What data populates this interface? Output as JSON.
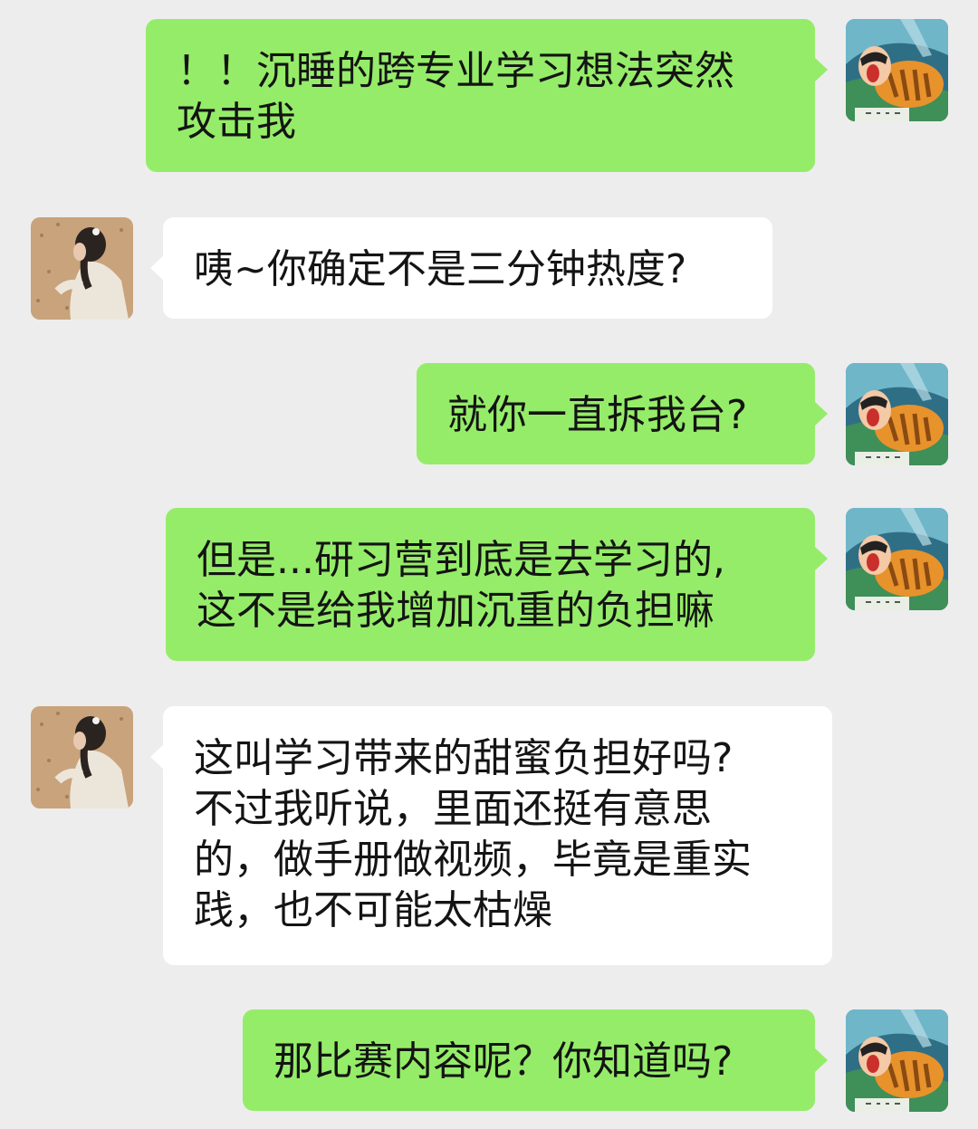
{
  "messages": [
    {
      "sender": "me",
      "text": "！！沉睡的跨专业学习想法突然\n攻击我"
    },
    {
      "sender": "friend",
      "text": "咦~你确定不是三分钟热度?"
    },
    {
      "sender": "me",
      "text": "就你一直拆我台?"
    },
    {
      "sender": "me",
      "text": "但是...研习营到底是去学习的,\n这不是给我增加沉重的负担嘛"
    },
    {
      "sender": "friend",
      "text": "这叫学习带来的甜蜜负担好吗?\n不过我听说，里面还挺有意思\n的，做手册做视频，毕竟是重实\n践，也不可能太枯燥"
    },
    {
      "sender": "me",
      "text": "那比赛内容呢？你知道吗?"
    }
  ],
  "avatars": {
    "me": "cartoon-cat-avatar",
    "friend": "girl-on-sand-avatar"
  },
  "colors": {
    "background": "#ededed",
    "sent_bubble": "#95ec69",
    "received_bubble": "#ffffff",
    "text": "#141414"
  }
}
